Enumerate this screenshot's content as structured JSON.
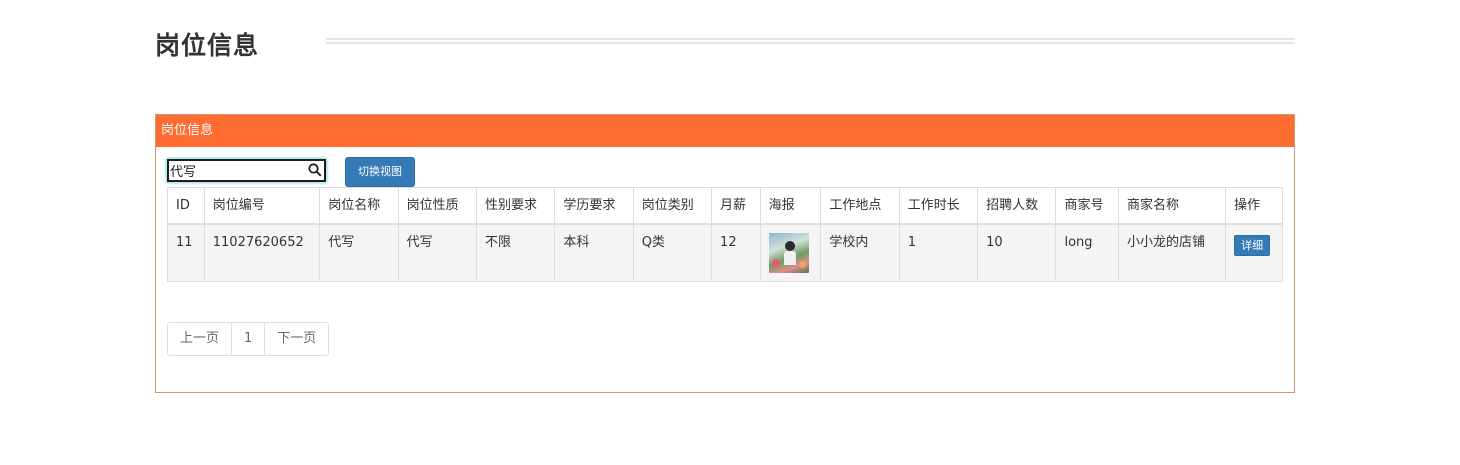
{
  "page": {
    "title": "岗位信息"
  },
  "panel": {
    "header": "岗位信息",
    "search": {
      "value": "代写",
      "icon": "search-icon"
    },
    "switch_view_label": "切换视图"
  },
  "table": {
    "columns": [
      "ID",
      "岗位编号",
      "岗位名称",
      "岗位性质",
      "性别要求",
      "学历要求",
      "岗位类别",
      "月薪",
      "海报",
      "工作地点",
      "工作时长",
      "招聘人数",
      "商家号",
      "商家名称",
      "操作"
    ],
    "rows": [
      {
        "id": "11",
        "code": "11027620652",
        "name": "代写",
        "nature": "代写",
        "gender": "不限",
        "education": "本科",
        "category": "Q类",
        "salary": "12",
        "poster": "poster-image",
        "location": "学校内",
        "duration": "1",
        "headcount": "10",
        "merchant_no": "long",
        "merchant_name": "小小龙的店铺",
        "action_label": "详细"
      }
    ]
  },
  "pager": {
    "prev": "上一页",
    "page": "1",
    "next": "下一页"
  },
  "colors": {
    "panel_header": "#ff6c32",
    "panel_border": "#d9956a",
    "primary_button": "#337ab7"
  }
}
